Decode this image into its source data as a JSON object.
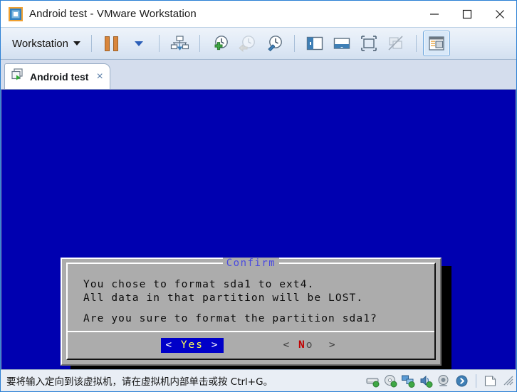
{
  "window": {
    "title": "Android test - VMware Workstation",
    "app_icon": "vmware-logo-icon",
    "controls": {
      "minimize": "minimize-icon",
      "maximize": "maximize-icon",
      "close": "close-icon"
    }
  },
  "toolbar": {
    "menu_label": "Workstation",
    "items": [
      {
        "name": "pause-vm-button",
        "icon": "pause-icon"
      },
      {
        "name": "power-dropdown-button",
        "icon": "chevron-down-icon"
      },
      {
        "name": "manage-vm-button",
        "icon": "vm-manage-icon"
      },
      {
        "name": "take-snapshot-button",
        "icon": "snapshot-add-icon"
      },
      {
        "name": "revert-snapshot-button",
        "icon": "snapshot-revert-icon"
      },
      {
        "name": "snapshot-manager-button",
        "icon": "snapshot-manager-icon"
      },
      {
        "name": "show-library-button",
        "icon": "library-panel-icon"
      },
      {
        "name": "show-thumbnails-button",
        "icon": "thumbnail-bar-icon"
      },
      {
        "name": "enter-fullscreen-button",
        "icon": "fullscreen-icon"
      },
      {
        "name": "unity-mode-button",
        "icon": "unity-mode-icon"
      },
      {
        "name": "console-view-button",
        "icon": "console-view-icon"
      }
    ]
  },
  "tabs": [
    {
      "label": "Android test",
      "icon": "vm-running-icon",
      "close": "×"
    }
  ],
  "vm_screen": {
    "background_color": "#0000b0",
    "dialog": {
      "title": "Confirm",
      "title_color": "#4a4ae0",
      "background_color": "#acacac",
      "lines": [
        "You chose to format sda1 to ext4.",
        "All data in that partition will be LOST.",
        "",
        "Are you sure to format the partition sda1?"
      ],
      "buttons": [
        {
          "name": "yes-button",
          "bracket_left": "<",
          "label": "Yes",
          "bracket_right": ">",
          "selected": true,
          "label_color": "#ffff55",
          "background_color": "#0000c8"
        },
        {
          "name": "no-button",
          "bracket_left": "<",
          "hotkey": "N",
          "label_rest": "o",
          "bracket_right": ">",
          "selected": false,
          "hotkey_color": "#c00000"
        }
      ]
    }
  },
  "statusbar": {
    "message": "要将输入定向到该虚拟机，请在虚拟机内部单击或按 Ctrl+G。",
    "devices": [
      {
        "name": "hard-disk-icon"
      },
      {
        "name": "cd-dvd-icon"
      },
      {
        "name": "network-adapter-icon"
      },
      {
        "name": "sound-card-icon"
      },
      {
        "name": "webcam-icon"
      },
      {
        "name": "bluetooth-icon"
      },
      {
        "name": "document-icon"
      }
    ],
    "grip": "resize-grip-icon"
  }
}
